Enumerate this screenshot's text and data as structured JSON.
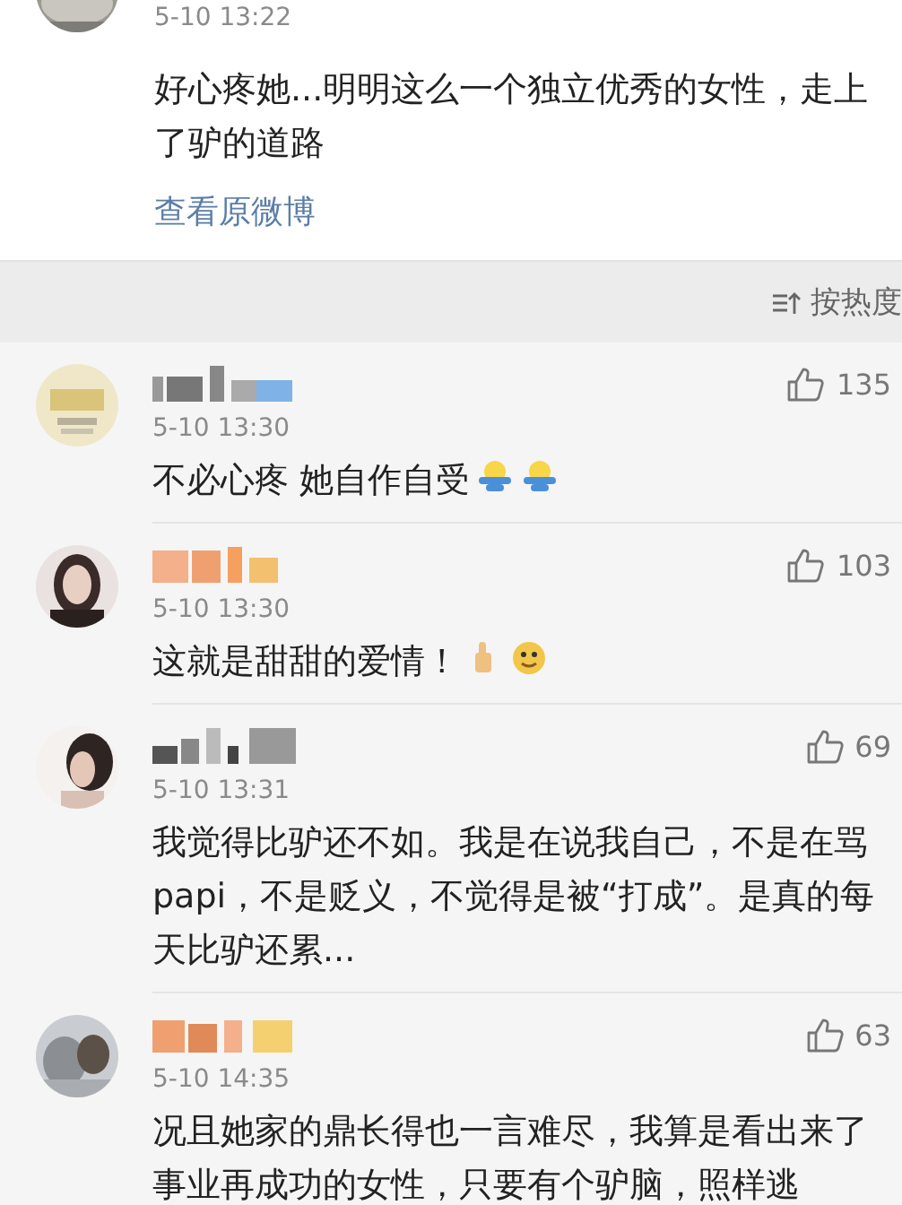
{
  "post": {
    "time": "5-10 13:22",
    "text": "好心疼她...明明这么一个独立优秀的女性，走上了驴的道路",
    "link": "查看原微博"
  },
  "sort": {
    "label": "按热度"
  },
  "comments": [
    {
      "time": "5-10 13:30",
      "text": "不必心疼 她自作自受",
      "emojis": [
        {
          "kind": "laugh"
        },
        {
          "kind": "laugh"
        }
      ],
      "likes": "135"
    },
    {
      "time": "5-10 13:30",
      "text": "这就是甜甜的爱情！",
      "emojis": [
        {
          "kind": "thumb"
        },
        {
          "kind": "doge"
        }
      ],
      "likes": "103"
    },
    {
      "time": "5-10 13:31",
      "text": "我觉得比驴还不如。我是在说我自己，不是在骂papi，不是贬义，不觉得是被“打成”。是真的每天比驴还累...",
      "likes": "69"
    },
    {
      "time": "5-10 14:35",
      "text": "况且她家的鼎长得也一言难尽，我算是看出来了事业再成功的女性，只要有个驴脑，照样逃",
      "likes": "63"
    }
  ]
}
